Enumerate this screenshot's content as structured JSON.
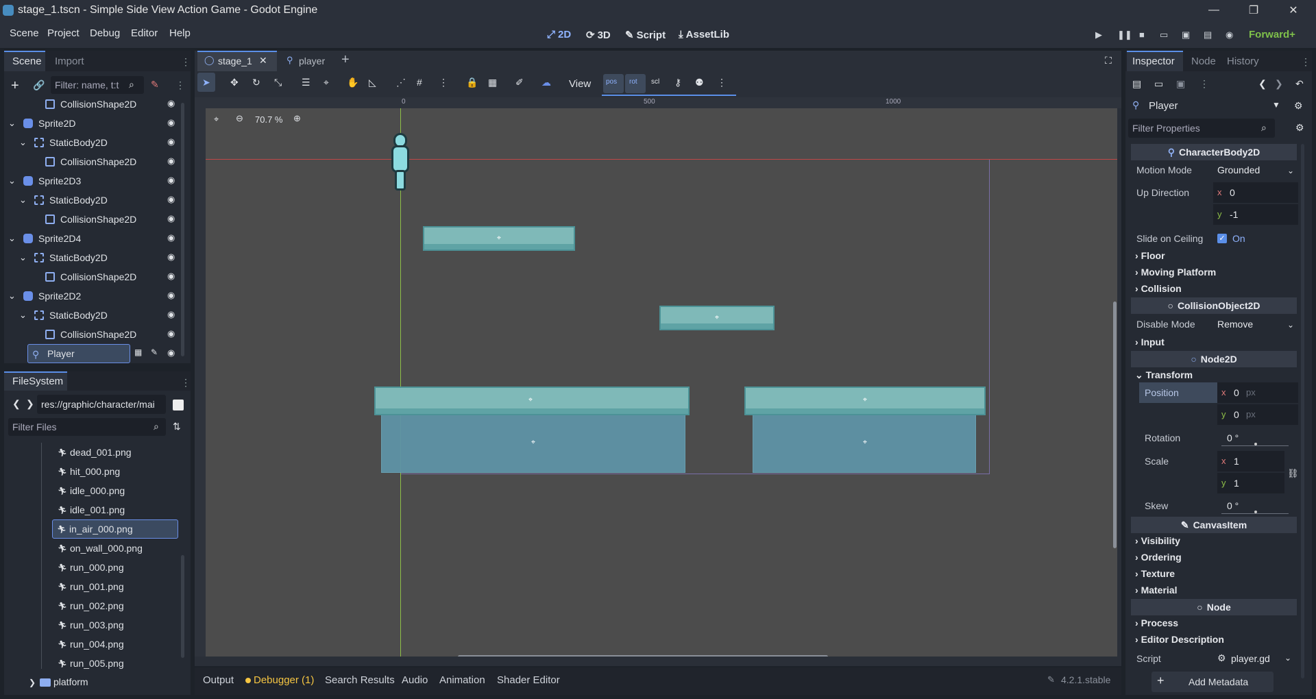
{
  "window": {
    "title": "stage_1.tscn - Simple Side View Action Game - Godot Engine"
  },
  "menu": [
    "Scene",
    "Project",
    "Debug",
    "Editor",
    "Help"
  ],
  "workspaces": [
    {
      "icon": "2d-icon",
      "label": "2D"
    },
    {
      "icon": "3d-icon",
      "label": "3D"
    },
    {
      "icon": "script-icon",
      "label": "Script"
    },
    {
      "icon": "assetlib-icon",
      "label": "AssetLib"
    }
  ],
  "renderer": "Forward+",
  "scene_dock": {
    "tabs": [
      "Scene",
      "Import"
    ],
    "filter_placeholder": "Filter: name, t:t",
    "nodes": [
      {
        "label": "CollisionShape2D",
        "type": "shape"
      },
      {
        "label": "Sprite2D",
        "type": "sprite"
      },
      {
        "label": "StaticBody2D",
        "type": "body"
      },
      {
        "label": "CollisionShape2D",
        "type": "shape"
      },
      {
        "label": "Sprite2D3",
        "type": "sprite"
      },
      {
        "label": "StaticBody2D",
        "type": "body"
      },
      {
        "label": "CollisionShape2D",
        "type": "shape"
      },
      {
        "label": "Sprite2D4",
        "type": "sprite"
      },
      {
        "label": "StaticBody2D",
        "type": "body"
      },
      {
        "label": "CollisionShape2D",
        "type": "shape"
      },
      {
        "label": "Sprite2D2",
        "type": "sprite"
      },
      {
        "label": "StaticBody2D",
        "type": "body"
      },
      {
        "label": "CollisionShape2D",
        "type": "shape"
      },
      {
        "label": "Player",
        "type": "player"
      }
    ]
  },
  "filesystem": {
    "tab": "FileSystem",
    "path": "res://graphic/character/mai",
    "filter_placeholder": "Filter Files",
    "files": [
      "dead_001.png",
      "hit_000.png",
      "idle_000.png",
      "idle_001.png",
      "in_air_000.png",
      "on_wall_000.png",
      "run_000.png",
      "run_001.png",
      "run_002.png",
      "run_003.png",
      "run_004.png",
      "run_005.png"
    ],
    "folder": "platform"
  },
  "editor_tabs": [
    {
      "label": "stage_1"
    },
    {
      "label": "player"
    }
  ],
  "toolbar": {
    "view_label": "View"
  },
  "viewport": {
    "zoom": "70.7 %",
    "ruler_marks": [
      "0",
      "500",
      "1000"
    ]
  },
  "inspector": {
    "tabs": [
      "Inspector",
      "Node",
      "History"
    ],
    "object": "Player",
    "filter_placeholder": "Filter Properties",
    "sections": {
      "character_body": "CharacterBody2D",
      "collision_object": "CollisionObject2D",
      "node2d": "Node2D",
      "canvas_item": "CanvasItem",
      "node": "Node"
    },
    "motion_mode": {
      "label": "Motion Mode",
      "value": "Grounded"
    },
    "up_direction": {
      "label": "Up Direction",
      "x": "0",
      "y": "-1"
    },
    "slide_on_ceiling": {
      "label": "Slide on Ceiling",
      "value": "On"
    },
    "categories1": [
      "Floor",
      "Moving Platform",
      "Collision"
    ],
    "disable_mode": {
      "label": "Disable Mode",
      "value": "Remove"
    },
    "input": "Input",
    "transform": "Transform",
    "position": {
      "label": "Position",
      "x": "0",
      "y": "0",
      "unit": "px"
    },
    "rotation": {
      "label": "Rotation",
      "value": "0 °"
    },
    "scale": {
      "label": "Scale",
      "x": "1",
      "y": "1"
    },
    "skew": {
      "label": "Skew",
      "value": "0 °"
    },
    "canvas_categories": [
      "Visibility",
      "Ordering",
      "Texture",
      "Material"
    ],
    "node_categories": [
      "Process",
      "Editor Description"
    ],
    "script": {
      "label": "Script",
      "value": "player.gd"
    },
    "add_metadata": "Add Metadata"
  },
  "bottom_tabs": [
    "Output",
    "Debugger (1)",
    "Search Results",
    "Audio",
    "Animation",
    "Shader Editor"
  ],
  "version": "4.2.1.stable"
}
